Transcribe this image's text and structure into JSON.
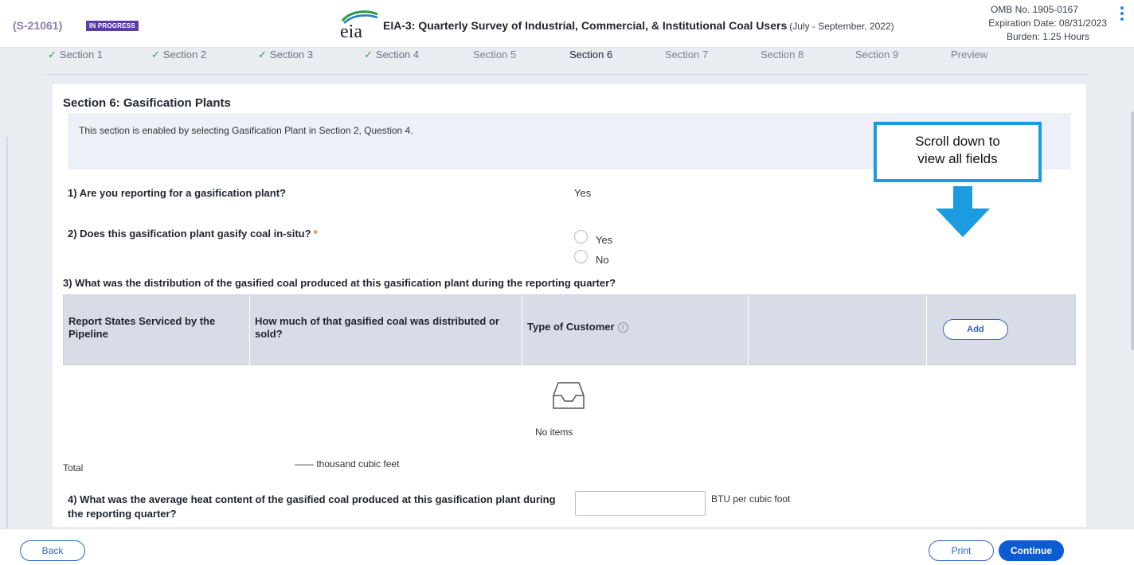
{
  "header": {
    "case_id": "(S-21061)",
    "status": "IN PROGRESS",
    "logo_text": "eia",
    "title": "EIA-3: Quarterly Survey of Industrial, Commercial, & Institutional Coal Users",
    "period": "(July - September, 2022)",
    "omb": "OMB No. 1905-0167",
    "expiration": "Expiration Date: 08/31/2023",
    "burden": "Burden: 1.25 Hours"
  },
  "steps": [
    {
      "label": "Section 1",
      "state": "done"
    },
    {
      "label": "Section 2",
      "state": "done"
    },
    {
      "label": "Section 3",
      "state": "done"
    },
    {
      "label": "Section 4",
      "state": "done"
    },
    {
      "label": "Section 5",
      "state": "pending"
    },
    {
      "label": "Section 6",
      "state": "current"
    },
    {
      "label": "Section 7",
      "state": "pending"
    },
    {
      "label": "Section 8",
      "state": "pending"
    },
    {
      "label": "Section 9",
      "state": "pending"
    },
    {
      "label": "Preview",
      "state": "pending"
    }
  ],
  "check_glyph": "✓",
  "section": {
    "title": "Section 6: Gasification Plants",
    "info": "This section is enabled by selecting Gasification Plant in Section 2, Question 4."
  },
  "q1": {
    "text": "1) Are you reporting for a gasification plant?",
    "answer": "Yes"
  },
  "q2": {
    "text": "2) Does this gasification plant gasify coal in-situ?",
    "required_mark": "*",
    "options": [
      "Yes",
      "No"
    ]
  },
  "q3": {
    "text": "3) What was the distribution of the gasified coal produced at this gasification plant during the reporting quarter?",
    "columns": [
      "Report States Serviced by the Pipeline",
      "How much of that gasified coal was distributed or sold?",
      "Type of Customer",
      ""
    ],
    "info_glyph": "i",
    "add_label": "Add",
    "empty_text": "No items",
    "total_label": "Total",
    "total_value": "—— thousand cubic feet"
  },
  "q4": {
    "text": "4) What was the average heat content of the gasified coal produced at this gasification plant during the reporting quarter?",
    "value": "",
    "unit": "BTU per cubic foot"
  },
  "callout": {
    "line1": "Scroll down to",
    "line2": "view all fields"
  },
  "footer": {
    "back": "Back",
    "print": "Print",
    "continue": "Continue"
  },
  "colors": {
    "accent": "#0b5bd3",
    "badge": "#5b3da6",
    "callout": "#1b9be0",
    "check": "#2ea043"
  }
}
